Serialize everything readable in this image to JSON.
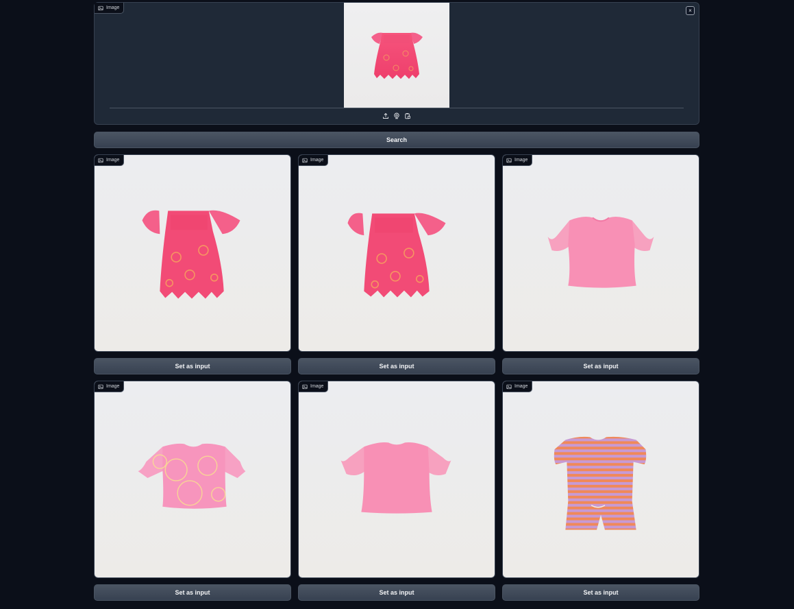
{
  "input": {
    "label": "Image",
    "close_icon": "close-icon",
    "tools": [
      "upload-icon",
      "webcam-icon",
      "clipboard-icon"
    ]
  },
  "search_button": "Search",
  "results": [
    {
      "label": "Image",
      "button": "Set as input",
      "garment": "pink-embroidered-blouse"
    },
    {
      "label": "Image",
      "button": "Set as input",
      "garment": "pink-embroidered-blouse"
    },
    {
      "label": "Image",
      "button": "Set as input",
      "garment": "pink-ruffle-sleeve-tshirt"
    },
    {
      "label": "Image",
      "button": "Set as input",
      "garment": "pink-patterned-tshirt"
    },
    {
      "label": "Image",
      "button": "Set as input",
      "garment": "pink-ruffle-sleeve-tshirt-back"
    },
    {
      "label": "Image",
      "button": "Set as input",
      "garment": "striped-tshirt-and-shorts-set"
    }
  ],
  "colors": {
    "background": "#0b0f19",
    "panel": "#1f2937",
    "button": "#4b5563",
    "garment_pink": "#f0527a",
    "garment_light_pink": "#f7a1bf",
    "stripe_orange": "#f0895a",
    "stripe_lilac": "#c79ad4"
  }
}
